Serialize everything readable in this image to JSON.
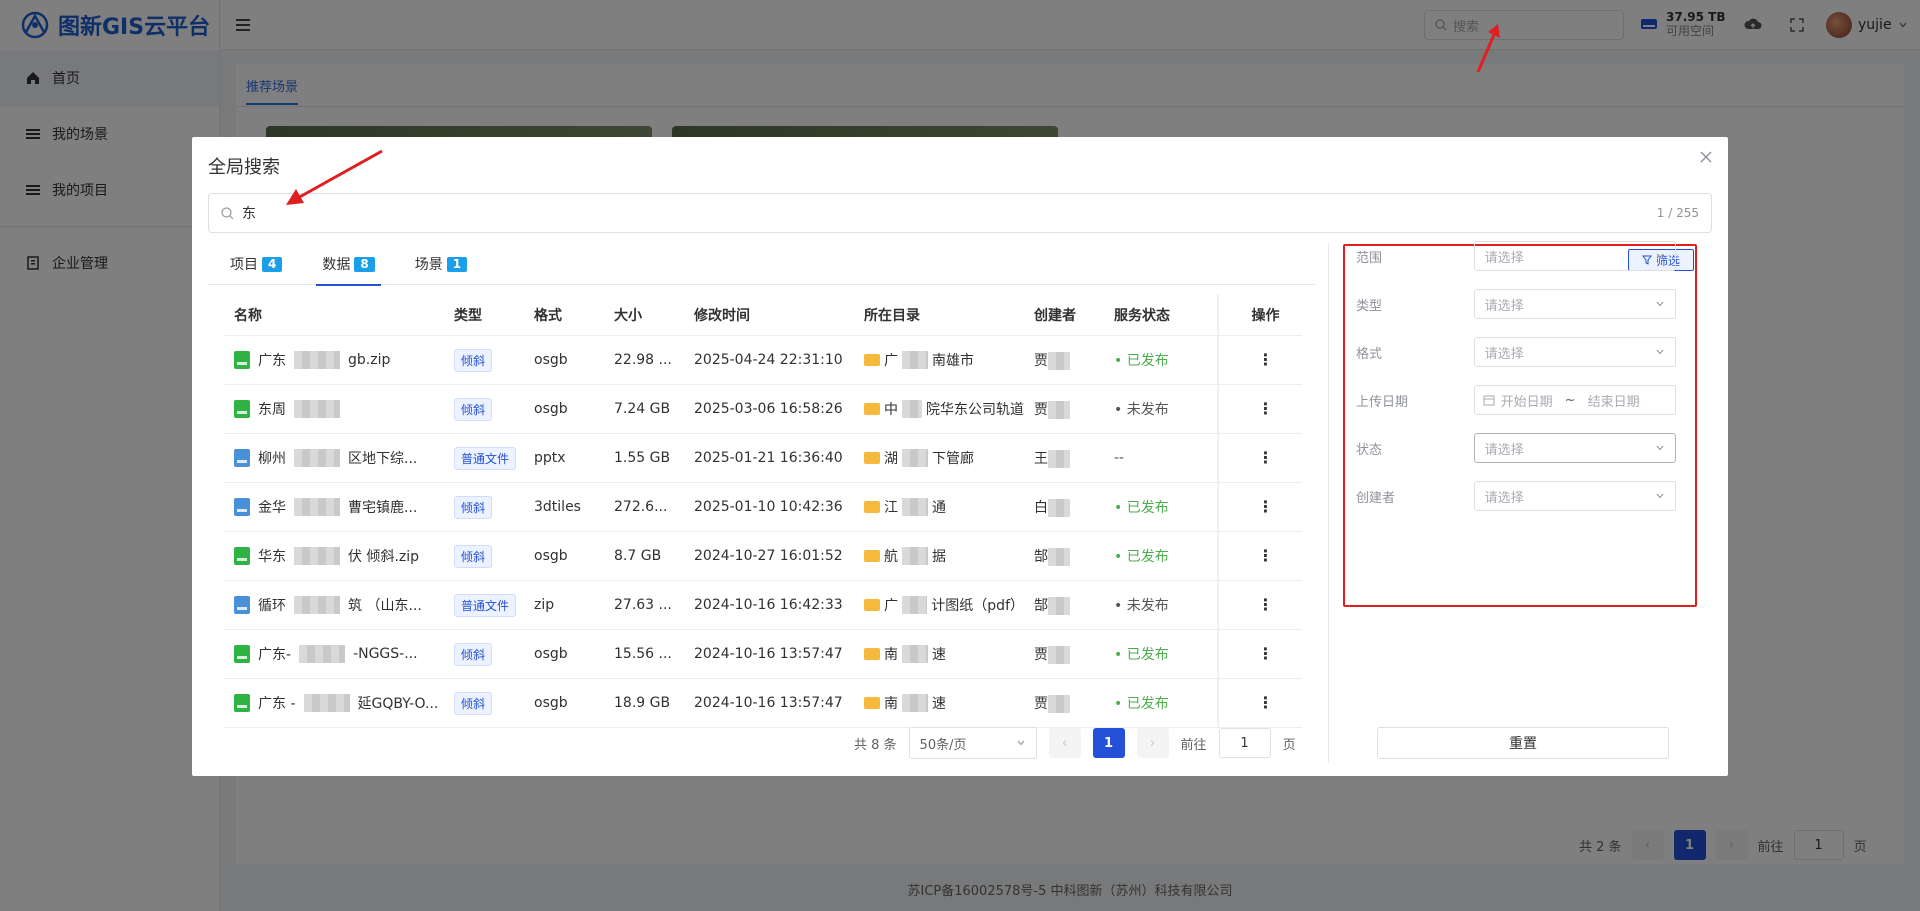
{
  "app": {
    "title": "图新GIS云平台"
  },
  "sidebar": {
    "items": [
      {
        "label": "首页",
        "icon": "home-icon"
      },
      {
        "label": "我的场景",
        "icon": "list-icon"
      },
      {
        "label": "我的项目",
        "icon": "list-icon"
      },
      {
        "label": "企业管理",
        "icon": "building-icon"
      }
    ]
  },
  "topbar": {
    "search_placeholder": "搜索",
    "disk_size": "37.95 TB",
    "disk_label": "可用空间",
    "username": "yujie"
  },
  "background": {
    "tab": "推荐场景",
    "total": "共 2 条",
    "current_page": "1",
    "goto_label": "前往",
    "goto_value": "1",
    "page_suffix": "页"
  },
  "footer": {
    "text": "苏ICP备16002578号-5 中科图新（苏州）科技有限公司"
  },
  "dialog": {
    "title": "全局搜索",
    "search_value": "东",
    "result_counter": "1 / 255",
    "tabs": [
      {
        "label": "项目",
        "count": "4"
      },
      {
        "label": "数据",
        "count": "8"
      },
      {
        "label": "场景",
        "count": "1"
      }
    ],
    "columns": [
      "名称",
      "类型",
      "格式",
      "大小",
      "修改时间",
      "所在目录",
      "创建者",
      "服务状态",
      "操作"
    ],
    "rows": [
      {
        "name_a": "广东",
        "name_b": "gb.zip",
        "type": "倾斜",
        "format": "osgb",
        "size": "22.98 ...",
        "modified": "2025-04-24 22:31:10",
        "dir_a": "广",
        "dir_b": "南雄市",
        "creator": "贾",
        "status": "• 已发布",
        "icon_color": "#2fb344"
      },
      {
        "name_a": "东周",
        "name_b": "",
        "type": "倾斜",
        "format": "osgb",
        "size": "7.24 GB",
        "modified": "2025-03-06 16:58:26",
        "dir_a": "中",
        "dir_b": "院华东公司轨道",
        "creator": "贾",
        "status": "• 未发布",
        "icon_color": "#2fb344"
      },
      {
        "name_a": "柳州",
        "name_b": "区地下综...",
        "type": "普通文件",
        "format": "pptx",
        "size": "1.55 GB",
        "modified": "2025-01-21 16:36:40",
        "dir_a": "湖",
        "dir_b": "下管廊",
        "creator": "王",
        "status": "--",
        "icon_color": "#4a90d9"
      },
      {
        "name_a": "金华",
        "name_b": "曹宅镇鹿...",
        "type": "倾斜",
        "format": "3dtiles",
        "size": "272.6...",
        "modified": "2025-01-10 10:42:36",
        "dir_a": "江",
        "dir_b": "通",
        "creator": "白",
        "status": "• 已发布",
        "icon_color": "#4a90d9"
      },
      {
        "name_a": "华东",
        "name_b": "伏 倾斜.zip",
        "type": "倾斜",
        "format": "osgb",
        "size": "8.7 GB",
        "modified": "2024-10-27 16:01:52",
        "dir_a": "航",
        "dir_b": "据",
        "creator": "郜",
        "status": "• 已发布",
        "icon_color": "#2fb344"
      },
      {
        "name_a": "循环",
        "name_b": "筑 （山东...",
        "type": "普通文件",
        "format": "zip",
        "size": "27.63 ...",
        "modified": "2024-10-16 16:42:33",
        "dir_a": "广",
        "dir_b": "计图纸（pdf）",
        "creator": "郜",
        "status": "• 未发布",
        "icon_color": "#4a90d9"
      },
      {
        "name_a": "广东-",
        "name_b": "-NGGS-...",
        "type": "倾斜",
        "format": "osgb",
        "size": "15.56 ...",
        "modified": "2024-10-16 13:57:47",
        "dir_a": "南",
        "dir_b": "速",
        "creator": "贾",
        "status": "• 已发布",
        "icon_color": "#2fb344"
      },
      {
        "name_a": "广东 -",
        "name_b": "延GQBY-O...",
        "type": "倾斜",
        "format": "osgb",
        "size": "18.9 GB",
        "modified": "2024-10-16 13:57:47",
        "dir_a": "南",
        "dir_b": "速",
        "creator": "贾",
        "status": "• 已发布",
        "icon_color": "#2fb344"
      }
    ],
    "pager": {
      "total": "共 8 条",
      "page_size": "50条/页",
      "current_page": "1",
      "goto_label": "前往",
      "goto_value": "1",
      "page_suffix": "页"
    },
    "filter": {
      "button_label": "筛选",
      "fields": [
        {
          "label": "范围",
          "placeholder": "请选择"
        },
        {
          "label": "类型",
          "placeholder": "请选择"
        },
        {
          "label": "格式",
          "placeholder": "请选择"
        },
        {
          "label": "上传日期",
          "start": "开始日期",
          "sep": "~",
          "end": "结束日期"
        },
        {
          "label": "状态",
          "placeholder": "请选择"
        },
        {
          "label": "创建者",
          "placeholder": "请选择"
        }
      ],
      "reset_label": "重置"
    }
  },
  "colors": {
    "accent": "#2450d8",
    "published": "#4cae4c",
    "highlight": "#e02020",
    "badge": "#1b9fe8"
  }
}
